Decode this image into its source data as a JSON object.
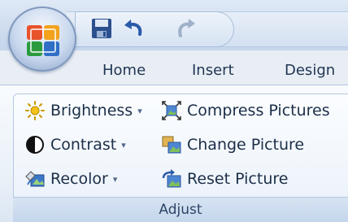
{
  "tabs": [
    {
      "label": "Home"
    },
    {
      "label": "Insert"
    },
    {
      "label": "Design"
    }
  ],
  "quick_access": {
    "icons": [
      "save-icon",
      "undo-icon",
      "redo-icon",
      "customize-dropdown-icon"
    ],
    "dropdown_glyph": "▾",
    "customize_glyph": "="
  },
  "adjust_group": {
    "title": "Adjust",
    "commands": {
      "brightness": {
        "label": "Brightness",
        "has_dropdown": true,
        "arrow": "▾"
      },
      "contrast": {
        "label": "Contrast",
        "has_dropdown": true,
        "arrow": "▾"
      },
      "recolor": {
        "label": "Recolor",
        "has_dropdown": true,
        "arrow": "▾"
      },
      "compress": {
        "label": "Compress Pictures"
      },
      "change": {
        "label": "Change Picture"
      },
      "reset": {
        "label": "Reset Picture"
      }
    }
  },
  "colors": {
    "ribbon_bg": "#eef4fb",
    "tab_text": "#1f3552",
    "group_title": "#2c4567"
  }
}
